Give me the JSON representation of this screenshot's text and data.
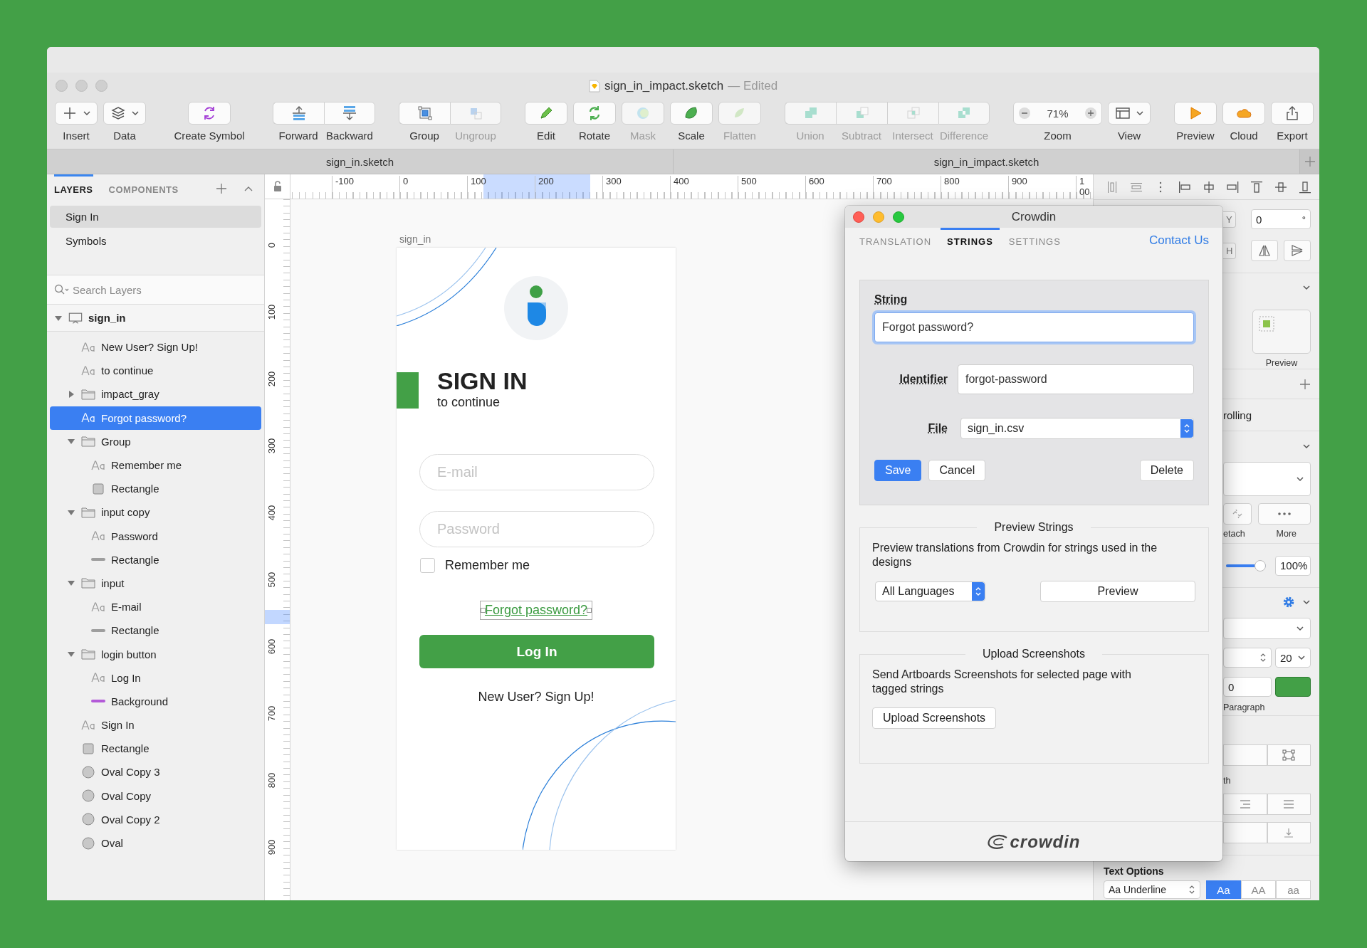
{
  "window": {
    "title": "sign_in_impact.sketch",
    "edited": "— Edited"
  },
  "toolbar": {
    "sections": [
      {
        "groups": [
          {
            "items": [
              {
                "kind": "dropdown",
                "label": "Insert",
                "disabled": false
              }
            ]
          },
          {
            "items": [
              {
                "kind": "dropdown",
                "label": "Data",
                "disabled": false
              }
            ]
          }
        ]
      },
      {
        "groups": [
          {
            "items": [
              {
                "kind": "button",
                "label": "Create Symbol",
                "disabled": false
              }
            ]
          }
        ]
      },
      {
        "groups": [
          {
            "items": [
              {
                "kind": "button",
                "label": "Forward",
                "disabled": false
              },
              {
                "kind": "button",
                "label": "Backward",
                "disabled": false
              }
            ]
          }
        ]
      },
      {
        "groups": [
          {
            "items": [
              {
                "kind": "button",
                "label": "Group",
                "disabled": false
              },
              {
                "kind": "button",
                "label": "Ungroup",
                "disabled": true
              }
            ]
          }
        ]
      },
      {
        "groups": [
          {
            "items": [
              {
                "kind": "button",
                "label": "Edit",
                "disabled": false
              }
            ]
          },
          {
            "items": [
              {
                "kind": "button",
                "label": "Rotate",
                "disabled": false
              }
            ]
          },
          {
            "items": [
              {
                "kind": "button",
                "label": "Mask",
                "disabled": true
              }
            ]
          },
          {
            "items": [
              {
                "kind": "button",
                "label": "Scale",
                "disabled": false
              }
            ]
          },
          {
            "items": [
              {
                "kind": "button",
                "label": "Flatten",
                "disabled": true
              }
            ]
          }
        ]
      },
      {
        "groups": [
          {
            "items": [
              {
                "kind": "button",
                "label": "Union",
                "disabled": true
              },
              {
                "kind": "button",
                "label": "Subtract",
                "disabled": true
              },
              {
                "kind": "button",
                "label": "Intersect",
                "disabled": true
              },
              {
                "kind": "button",
                "label": "Difference",
                "disabled": true
              }
            ]
          }
        ]
      },
      {
        "groups": [
          {
            "items": [
              {
                "kind": "zoom",
                "label": "Zoom",
                "value": "71%",
                "disabled": false
              }
            ]
          },
          {
            "items": [
              {
                "kind": "dropdown",
                "label": "View",
                "disabled": false
              }
            ]
          }
        ]
      },
      {
        "groups": [
          {
            "items": [
              {
                "kind": "button",
                "label": "Preview",
                "disabled": false
              }
            ]
          },
          {
            "items": [
              {
                "kind": "button",
                "label": "Cloud",
                "disabled": false
              }
            ]
          },
          {
            "items": [
              {
                "kind": "button",
                "label": "Export",
                "disabled": false
              }
            ]
          }
        ]
      }
    ]
  },
  "document_tabs": [
    {
      "label": "sign_in.sketch"
    },
    {
      "label": "sign_in_impact.sketch"
    }
  ],
  "layers_panel": {
    "tabs": [
      {
        "label": "LAYERS",
        "selected": true
      },
      {
        "label": "COMPONENTS",
        "selected": false
      }
    ],
    "pages": [
      {
        "label": "Sign In",
        "selected": true
      },
      {
        "label": "Symbols",
        "selected": false
      }
    ],
    "search": {
      "placeholder": "Search Layers"
    },
    "layers": [
      {
        "kind": "artboard",
        "name": "sign_in",
        "expanded": true,
        "selected": false,
        "children": [
          {
            "kind": "text",
            "name": "New User? Sign Up!",
            "selected": false
          },
          {
            "kind": "text",
            "name": "to continue",
            "selected": false
          },
          {
            "kind": "folder",
            "name": "impact_gray",
            "expanded": false,
            "selected": false
          },
          {
            "kind": "text",
            "name": "Forgot password?",
            "selected": true
          },
          {
            "kind": "folder",
            "name": "Group",
            "expanded": true,
            "selected": false,
            "children": [
              {
                "kind": "text",
                "name": "Remember me",
                "selected": false
              },
              {
                "kind": "rectangle",
                "name": "Rectangle",
                "selected": false
              }
            ]
          },
          {
            "kind": "folder",
            "name": "input copy",
            "expanded": true,
            "selected": false,
            "children": [
              {
                "kind": "text",
                "name": "Password",
                "selected": false
              },
              {
                "kind": "line",
                "name": "Rectangle",
                "selected": false,
                "color": "#9e9e9e"
              }
            ]
          },
          {
            "kind": "folder",
            "name": "input",
            "expanded": true,
            "selected": false,
            "children": [
              {
                "kind": "text",
                "name": "E-mail",
                "selected": false
              },
              {
                "kind": "line",
                "name": "Rectangle",
                "selected": false,
                "color": "#9e9e9e"
              }
            ]
          },
          {
            "kind": "folder",
            "name": "login button",
            "expanded": true,
            "selected": false,
            "children": [
              {
                "kind": "text",
                "name": "Log In",
                "selected": false
              },
              {
                "kind": "line",
                "name": "Background",
                "selected": false,
                "color": "#b35ad8"
              }
            ]
          },
          {
            "kind": "text",
            "name": "Sign In",
            "selected": false
          },
          {
            "kind": "rectangle",
            "name": "Rectangle",
            "selected": false
          },
          {
            "kind": "oval",
            "name": "Oval Copy 3",
            "selected": false
          },
          {
            "kind": "oval",
            "name": "Oval Copy",
            "selected": false
          },
          {
            "kind": "oval",
            "name": "Oval Copy 2",
            "selected": false
          },
          {
            "kind": "oval",
            "name": "Oval",
            "selected": false
          }
        ]
      }
    ]
  },
  "canvas": {
    "h_ruler": [
      "-100",
      "0",
      "100",
      "200",
      "300",
      "400",
      "500",
      "600",
      "700",
      "800",
      "900",
      "1 00"
    ],
    "v_ruler": [
      "0",
      "100",
      "200",
      "300",
      "400",
      "500",
      "600",
      "700",
      "800",
      "900"
    ],
    "artboard": {
      "label": "sign_in",
      "title": "SIGN IN",
      "subtitle": "to continue",
      "fields": [
        {
          "placeholder": "E-mail"
        },
        {
          "placeholder": "Password"
        }
      ],
      "remember": {
        "label": "Remember me",
        "checked": false
      },
      "forgot": {
        "label": "Forgot password?",
        "selected": true
      },
      "login": "Log In",
      "signup": "New User? Sign Up!"
    }
  },
  "inspector": {
    "y_label": "Y",
    "rotation": "0",
    "degree": "°",
    "h_label": "H",
    "preview": "Preview",
    "scrolling": "rolling",
    "detach": "etach",
    "more": "More",
    "opacity": {
      "level": 1,
      "reading": "100%"
    },
    "font_size": "20",
    "spacing": "0",
    "fill": {
      "color": "#43a047"
    },
    "paragraph": "Paragraph",
    "width_label": "th",
    "text_options": {
      "title": "Text Options",
      "decoration": "Aa Underline",
      "cases": [
        {
          "label": "Aa",
          "selected": true
        },
        {
          "label": "AA",
          "selected": false
        },
        {
          "label": "aa",
          "selected": false
        }
      ]
    }
  },
  "crowdin": {
    "title": "Crowdin",
    "tabs": [
      {
        "label": "TRANSLATION",
        "selected": false
      },
      {
        "label": "STRINGS",
        "selected": true
      },
      {
        "label": "SETTINGS",
        "selected": false
      }
    ],
    "contact": "Contact Us",
    "string_form": {
      "string_label": "String",
      "string_value": "Forgot password?",
      "identifier_label": "Identifier",
      "identifier_value": "forgot-password",
      "file_label": "File",
      "file_value": "sign_in.csv",
      "actions": [
        {
          "label": "Save",
          "kind": "primary"
        },
        {
          "label": "Cancel",
          "kind": "plain"
        }
      ],
      "end_actions": [
        {
          "label": "Delete",
          "kind": "plain"
        }
      ]
    },
    "preview_strings": {
      "title": "Preview Strings",
      "text": "Preview translations from Crowdin for strings used in the designs",
      "language": "All Languages",
      "button": "Preview"
    },
    "upload": {
      "title": "Upload Screenshots",
      "text": "Send Artboards Screenshots for selected page with tagged strings",
      "button": "Upload Screenshots"
    },
    "footer": {
      "logo": "crowdin"
    }
  }
}
